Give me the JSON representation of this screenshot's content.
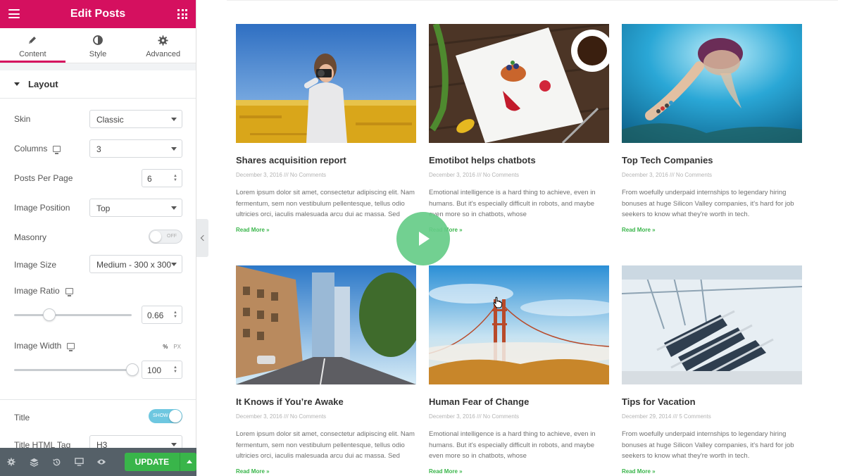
{
  "panel": {
    "title": "Edit Posts",
    "tabs": [
      {
        "label": "Content",
        "icon": "pencil-icon",
        "active": true
      },
      {
        "label": "Style",
        "icon": "contrast-icon",
        "active": false
      },
      {
        "label": "Advanced",
        "icon": "gear-icon",
        "active": false
      }
    ],
    "section_title": "Layout",
    "controls": {
      "skin": {
        "label": "Skin",
        "value": "Classic"
      },
      "columns": {
        "label": "Columns",
        "value": "3"
      },
      "posts_per_page": {
        "label": "Posts Per Page",
        "value": "6"
      },
      "image_position": {
        "label": "Image Position",
        "value": "Top"
      },
      "masonry": {
        "label": "Masonry",
        "state": "OFF"
      },
      "image_size": {
        "label": "Image Size",
        "value": "Medium - 300 x 300"
      },
      "image_ratio": {
        "label": "Image Ratio",
        "value": "0.66"
      },
      "image_width": {
        "label": "Image Width",
        "value": "100",
        "units": [
          "%",
          "PX"
        ]
      },
      "title": {
        "label": "Title",
        "state": "SHOW"
      },
      "title_tag": {
        "label": "Title HTML Tag",
        "value": "H3"
      }
    },
    "footer": {
      "update_label": "UPDATE"
    },
    "accent_color": "#d5105f"
  },
  "posts": [
    {
      "title": "Shares acquisition report",
      "meta": "December 3, 2016 /// No Comments",
      "excerpt": "Lorem ipsum dolor sit amet, consectetur adipiscing elit. Nam fermentum, sem non vestibulum pellentesque, tellus odio ultricies orci, iaculis malesuada arcu dui ac massa. Sed",
      "more": "Read More »"
    },
    {
      "title": "Emotibot helps chatbots",
      "meta": "December 3, 2016 /// No Comments",
      "excerpt": "Emotional intelligence is a hard thing to achieve, even in humans. But it's especially difficult in robots, and maybe even more so in chatbots, whose",
      "more": "Read More »"
    },
    {
      "title": "Top Tech Companies",
      "meta": "December 3, 2016 /// No Comments",
      "excerpt": "From woefully underpaid internships to legendary hiring bonuses at huge Silicon Valley companies, it's hard for job seekers to know what they're worth in tech.",
      "more": "Read More »"
    },
    {
      "title": "It Knows if You’re Awake",
      "meta": "December 3, 2016 /// No Comments",
      "excerpt": "Lorem ipsum dolor sit amet, consectetur adipiscing elit. Nam fermentum, sem non vestibulum pellentesque, tellus odio ultricies orci, iaculis malesuada arcu dui ac massa. Sed",
      "more": "Read More »"
    },
    {
      "title": "Human Fear of Change",
      "meta": "December 3, 2016 /// No Comments",
      "excerpt": "Emotional intelligence is a hard thing to achieve, even in humans. But it's especially difficult in robots, and maybe even more so in chatbots, whose",
      "more": "Read More »"
    },
    {
      "title": "Tips for Vacation",
      "meta": "December 29, 2014 /// 5 Comments",
      "excerpt": "From woefully underpaid internships to legendary hiring bonuses at huge Silicon Valley companies, it's hard for job seekers to know what they're worth in tech.",
      "more": "Read More »"
    }
  ]
}
